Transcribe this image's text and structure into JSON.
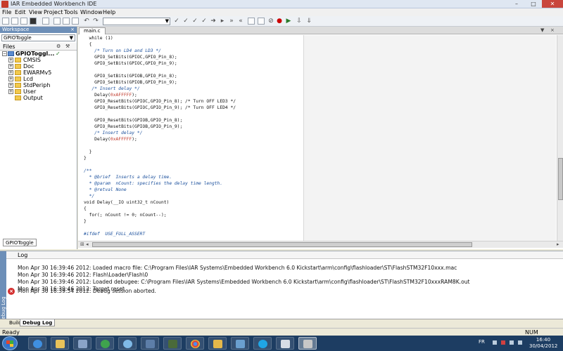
{
  "window": {
    "title": "IAR Embedded Workbench IDE",
    "min_glyph": "–",
    "max_glyph": "□",
    "close_glyph": "✕"
  },
  "menu": [
    "File",
    "Edit",
    "View",
    "Project",
    "Tools",
    "Window",
    "Help"
  ],
  "workspace": {
    "header": "Workspace",
    "close_glyph": "×",
    "config": "GPIOToggle",
    "files_label": "Files",
    "root": "GPIOToggl...",
    "folders": [
      "CMSIS",
      "Doc",
      "EWARMv5",
      "Lcd",
      "StdPeriph",
      "User",
      "Output"
    ],
    "bottom_tab": "GPIOToggle"
  },
  "editor": {
    "tab": "main.c",
    "code_lines": [
      {
        "t": "  while (1)",
        "k": "code"
      },
      {
        "t": "  {",
        "k": "code"
      },
      {
        "t": "    /* Turn on LD4 and LD3 */",
        "k": "comment"
      },
      {
        "t": "    GPIO_SetBits(GPIOC,GPIO_Pin_8);",
        "k": "code"
      },
      {
        "t": "    GPIO_SetBits(GPIOC,GPIO_Pin_9);",
        "k": "code"
      },
      {
        "t": "",
        "k": "code"
      },
      {
        "t": "    GPIO_SetBits(GPIOB,GPIO_Pin_8);",
        "k": "code"
      },
      {
        "t": "    GPIO_SetBits(GPIOB,GPIO_Pin_9);",
        "k": "code"
      },
      {
        "t": "   /* Insert delay */",
        "k": "comment"
      },
      {
        "t": "    Delay(0xAFFFFF);",
        "k": "num"
      },
      {
        "t": "    GPIO_ResetBits(GPIOC,GPIO_Pin_8); /* Turn OFF LED3 */",
        "k": "code"
      },
      {
        "t": "    GPIO_ResetBits(GPIOC,GPIO_Pin_9); /* Turn OFF LED4 */",
        "k": "code"
      },
      {
        "t": "",
        "k": "code"
      },
      {
        "t": "    GPIO_ResetBits(GPIOB,GPIO_Pin_8);",
        "k": "code"
      },
      {
        "t": "    GPIO_ResetBits(GPIOB,GPIO_Pin_9);",
        "k": "code"
      },
      {
        "t": "    /* Insert delay */",
        "k": "comment"
      },
      {
        "t": "    Delay(0xAFFFFF);",
        "k": "num"
      },
      {
        "t": "",
        "k": "code"
      },
      {
        "t": "  }",
        "k": "code"
      },
      {
        "t": "}",
        "k": "code"
      },
      {
        "t": "",
        "k": "code"
      },
      {
        "t": "/**",
        "k": "comment"
      },
      {
        "t": "  * @brief  Inserts a delay time.",
        "k": "comment"
      },
      {
        "t": "  * @param  nCount: specifies the delay time length.",
        "k": "comment"
      },
      {
        "t": "  * @retval None",
        "k": "comment"
      },
      {
        "t": "  */",
        "k": "comment"
      },
      {
        "t": "void Delay(__IO uint32_t nCount)",
        "k": "code"
      },
      {
        "t": "{",
        "k": "code"
      },
      {
        "t": "  for(; nCount != 0; nCount--);",
        "k": "code"
      },
      {
        "t": "}",
        "k": "code"
      },
      {
        "t": "",
        "k": "code"
      },
      {
        "t": "#ifdef  USE_FULL_ASSERT",
        "k": "comment"
      }
    ]
  },
  "log": {
    "header": "Log",
    "side_label": "Debug Log",
    "lines": [
      "Mon Apr 30 16:39:46 2012: Loaded macro file: C:\\Program Files\\IAR Systems\\Embedded Workbench 6.0 Kickstart\\arm\\config\\flashloader\\ST\\FlashSTM32F10xxx.mac",
      "Mon Apr 30 16:39:46 2012: Flash\\Loader\\Flash\\0",
      "Mon Apr 30 16:39:46 2012: Loaded debugee: C:\\Program Files\\IAR Systems\\Embedded Workbench 6.0 Kickstart\\arm\\config\\flashloader\\ST\\FlashSTM32F10xxxRAM8K.out",
      "Mon Apr 30 16:39:46 2012: Target reset",
      "Mon Apr 30 16:39:54 2012: Debug session aborted."
    ],
    "tabs": [
      "Build",
      "Debug Log"
    ]
  },
  "status": {
    "left": "Ready",
    "num": "NUM"
  },
  "taskbar": {
    "lang": "FR",
    "time": "16:40",
    "date": "30/04/2012"
  },
  "colors": {
    "panel_header": "#6d8fb8",
    "taskbar": "#1d3d62",
    "error": "#d32f2f"
  }
}
